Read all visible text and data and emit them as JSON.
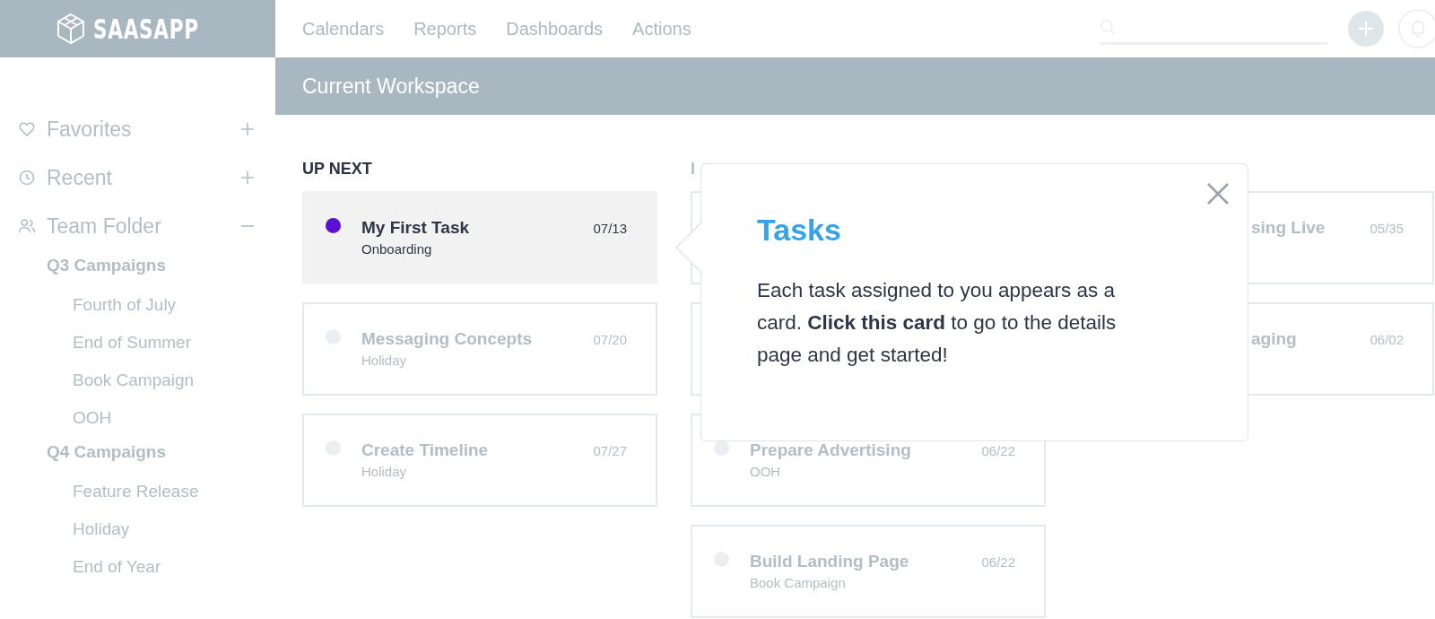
{
  "logo": {
    "text": "SAASAPP"
  },
  "nav": [
    "Calendars",
    "Reports",
    "Dashboards",
    "Actions"
  ],
  "workspace": {
    "title": "Current Workspace"
  },
  "sidebar": {
    "sections": [
      {
        "label": "Favorites",
        "expanded": false
      },
      {
        "label": "Recent",
        "expanded": false
      },
      {
        "label": "Team Folder",
        "expanded": true,
        "children": [
          {
            "label": "Q3 Campaigns",
            "children": [
              {
                "label": "Fourth of July"
              },
              {
                "label": "End of Summer"
              },
              {
                "label": "Book Campaign"
              },
              {
                "label": "OOH"
              }
            ]
          },
          {
            "label": "Q4 Campaigns",
            "children": [
              {
                "label": "Feature Release"
              },
              {
                "label": "Holiday"
              },
              {
                "label": "End of Year"
              }
            ]
          }
        ]
      }
    ]
  },
  "columns": [
    {
      "heading": "UP NEXT",
      "cards": [
        {
          "kind": "full",
          "title": "My First Task",
          "date": "07/13",
          "group": "Onboarding",
          "selected": true,
          "color": "#5b12d6"
        },
        {
          "kind": "full",
          "title": "Messaging Concepts",
          "date": "07/20",
          "group": "Holiday",
          "selected": false,
          "color": "#eceff2"
        },
        {
          "kind": "full",
          "title": "Create Timeline",
          "date": "07/27",
          "group": "Holiday",
          "selected": false,
          "color": "#eceff2"
        }
      ]
    },
    {
      "heading": "I",
      "cards": [
        {
          "kind": "covered"
        },
        {
          "kind": "covered"
        },
        {
          "kind": "full",
          "title": "Prepare Advertising",
          "date": "06/22",
          "group": "OOH",
          "selected": false,
          "color": "#eceff2"
        },
        {
          "kind": "full",
          "title": "Build Landing Page",
          "date": "06/22",
          "group": "Book Campaign",
          "selected": false,
          "color": "#eceff2"
        }
      ]
    },
    {
      "cards": [
        {
          "kind": "clipped",
          "title": "sing Live",
          "date": "05/35"
        },
        {
          "kind": "clipped",
          "title": "aging",
          "date": "06/02"
        }
      ]
    }
  ],
  "popup": {
    "title": "Tasks",
    "body": "Each task assigned to you appears as a card. **Click this card** to go to the details page and get started!"
  }
}
